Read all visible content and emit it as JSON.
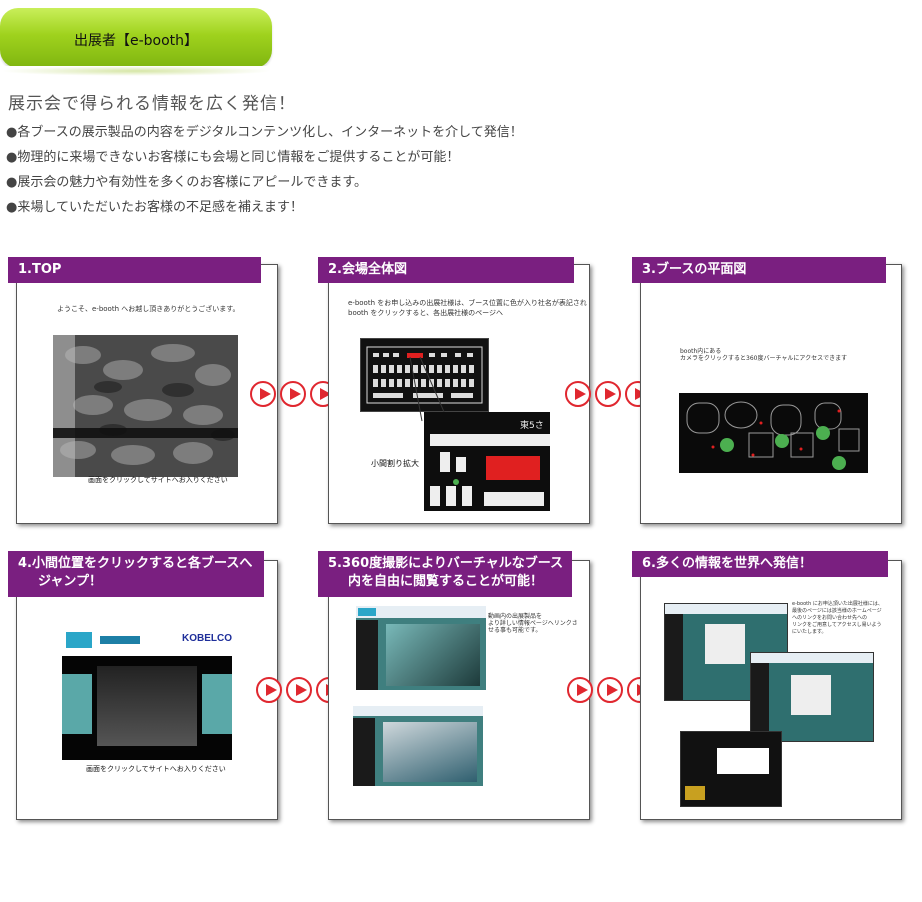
{
  "header": {
    "title": "出展者【e-booth】",
    "headline": "展示会で得られる情報を広く発信！",
    "bullets": [
      "●各ブースの展示製品の内容をデジタルコンテンツ化し、インターネットを介して発信！",
      "●物理的に来場できないお客様にも会場と同じ情報をご提供することが可能！",
      "●展示会の魅力や有効性を多くのお客様にアピールできます。",
      "●来場していただいたお客様の不足感を補えます！"
    ]
  },
  "steps": [
    {
      "title": "1.TOP",
      "caption": "ようこそ、e-booth へお越し頂きありがとうございます。",
      "screen_caption": "画面をクリックしてサイトへお入りください"
    },
    {
      "title": "2.会場全体図",
      "caption_line1": "e-booth をお申し込みの出展社様は、ブース位置に色が入り社名が表記され",
      "caption_line2": "booth をクリックすると、各出展社様のページへ",
      "zoom_label": "小間割り拡大",
      "zoom_code": "東5さ"
    },
    {
      "title": "3.ブースの平面図",
      "caption_line1": "booth内にある",
      "caption_line2": "カメラをクリックすると360度バーチャルにアクセスできます"
    },
    {
      "title_line1": "4.小間位置をクリックすると各ブースへ",
      "title_line2": "ジャンプ！",
      "logo": "KOBELCO",
      "screen_caption": "画面をクリックしてサイトへお入りください"
    },
    {
      "title_line1": "5.360度撮影によりバーチャルなブース",
      "title_line2": "内を自由に閲覧することが可能！",
      "caption_line1": "動画内の出展製品を",
      "caption_line2": "より詳しい情報ページへリンクさ",
      "caption_line3": "せる事も可能です。"
    },
    {
      "title": "6.多くの情報を世界へ発信！",
      "caption_line1": "e-booth にお申込頂いた出展社様には、",
      "caption_line2": "最後のページには該当様のホームページ",
      "caption_line3": "へのリンクをお問い合わせ先への",
      "caption_line4": "リンクをご用意してアクセスし易いよう",
      "caption_line5": "にいたします。"
    }
  ],
  "colors": {
    "ribbon": "#7a1f80",
    "arrow": "#e0272f",
    "pill": "#9fd21d"
  }
}
